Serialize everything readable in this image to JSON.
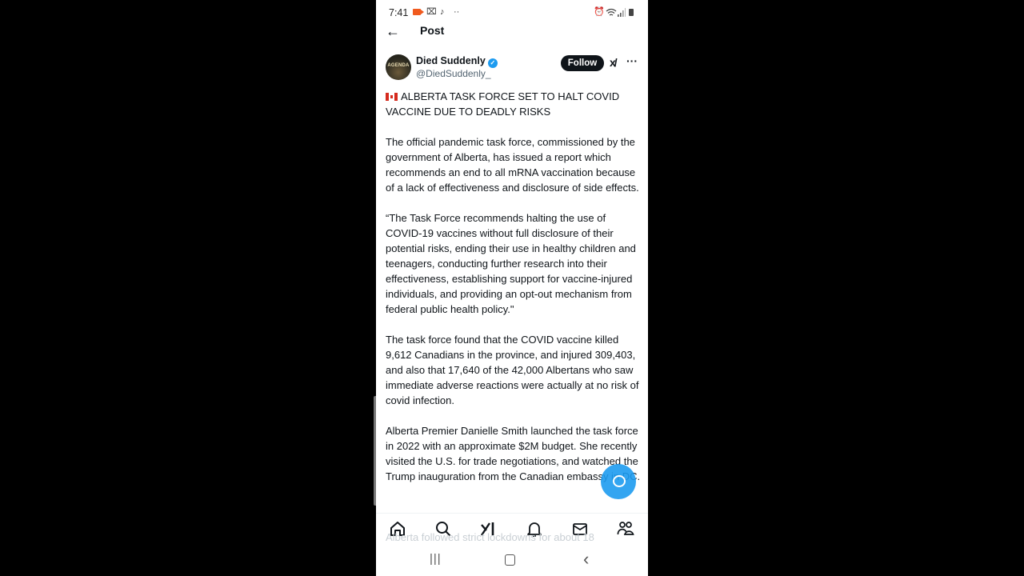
{
  "status_bar": {
    "time": "7:41",
    "left_icons": [
      "screen-record-icon",
      "capcut-icon",
      "tiktok-icon",
      "more-notifications-icon"
    ],
    "right_icons": [
      "alarm-icon",
      "wifi-icon",
      "signal-icon",
      "battery-icon"
    ]
  },
  "header": {
    "back_icon": "arrow-left-icon",
    "title": "Post"
  },
  "author": {
    "avatar_text": "AGENDA",
    "display_name": "Died Suddenly",
    "verified": true,
    "handle": "@DiedSuddenly_",
    "follow_label": "Follow",
    "grok_label": "x/",
    "more_label": "···"
  },
  "post": {
    "flag": "canada-flag",
    "paragraphs": [
      "ALBERTA TASK FORCE SET TO HALT COVID VACCINE DUE TO DEADLY RISKS",
      "The official pandemic task force, commissioned by the government of Alberta, has issued a report which recommends an end to all mRNA vaccination because of a lack of effectiveness and disclosure of side effects.",
      "“The Task Force recommends halting the use of COVID-19 vaccines without full disclosure of their potential risks, ending their use in healthy children and teenagers, conducting further research into their effectiveness, establishing support for vaccine-injured individuals, and providing an opt-out mechanism from federal public health policy.\"",
      "The task force found that the COVID vaccine killed 9,612 Canadians in the province, and injured 309,403, and also that 17,640 of the 42,000 Albertans who saw immediate adverse reactions were actually at no risk of covid infection.",
      "Alberta Premier Danielle Smith launched the task force in 2022 with an approximate $2M budget. She recently visited the U.S. for trade negotiations, and watched the Trump inauguration from the Canadian embassy in DC."
    ],
    "next_paragraph_partial": "Alberta followed strict lockdowns for about 18"
  },
  "fab": {
    "icon": "compose-reply-icon"
  },
  "tab_bar": {
    "items": [
      {
        "name": "home",
        "icon": "home-icon"
      },
      {
        "name": "search",
        "icon": "search-icon"
      },
      {
        "name": "grok",
        "icon": "grok-icon"
      },
      {
        "name": "notifications",
        "icon": "bell-icon"
      },
      {
        "name": "messages",
        "icon": "mail-icon"
      },
      {
        "name": "communities",
        "icon": "people-icon"
      }
    ]
  },
  "nav_bar": {
    "recents_label": "|||",
    "home_icon": "home-circle-icon",
    "back_label": "‹"
  },
  "colors": {
    "accent": "#1d9bf0",
    "text": "#0f1419",
    "secondary": "#536471",
    "record": "#f05a1e"
  }
}
